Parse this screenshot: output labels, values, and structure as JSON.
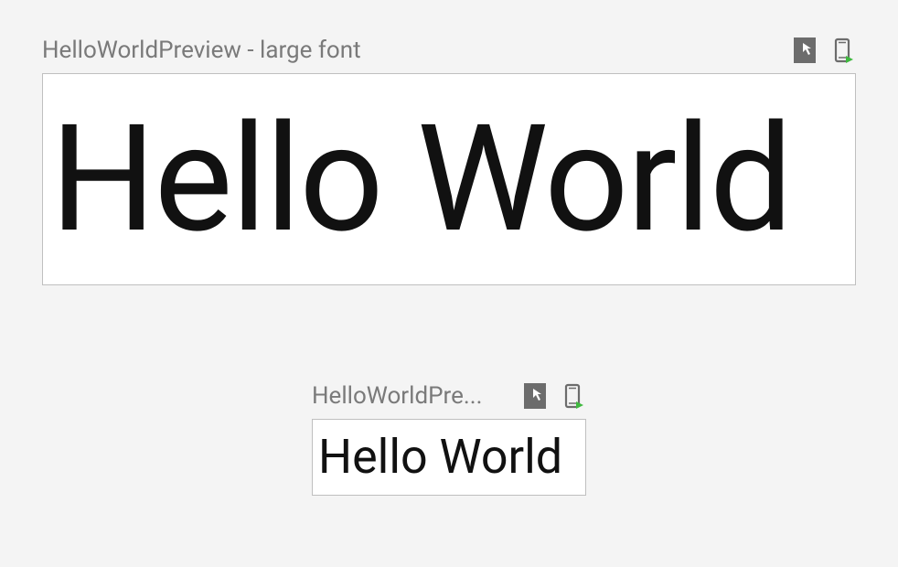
{
  "previews": {
    "large": {
      "title": "HelloWorldPreview - large font",
      "content": "Hello World"
    },
    "small": {
      "title": "HelloWorldPre...",
      "content": "Hello World"
    }
  },
  "icons": {
    "interactive": "interactive-mode-icon",
    "deploy": "deploy-to-device-icon"
  }
}
